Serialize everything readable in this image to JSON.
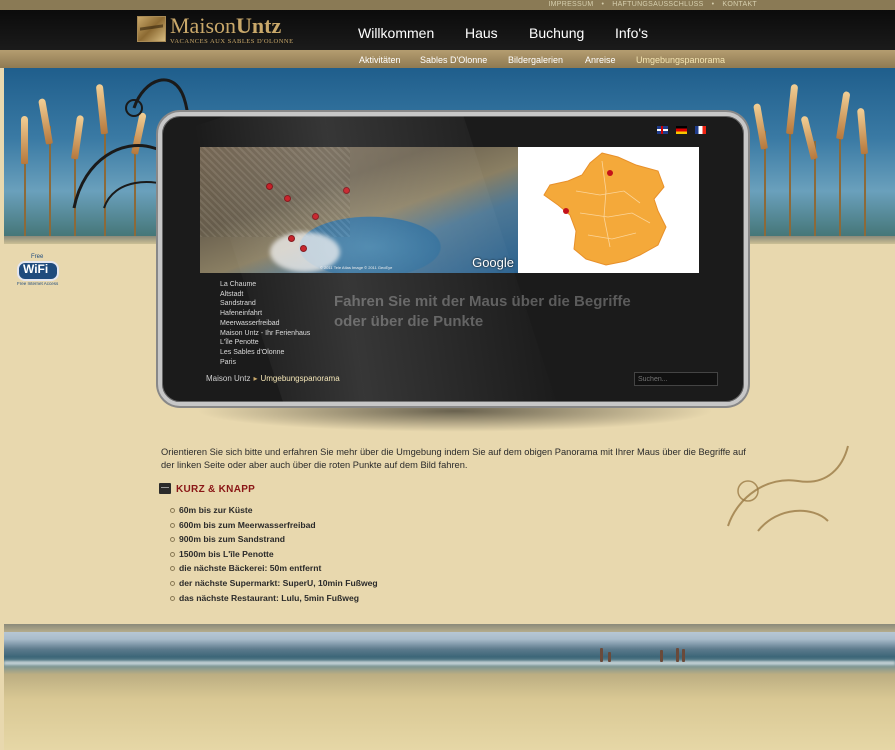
{
  "top_links": [
    "IMPRESSUM",
    "HAFTUNGSAUSSCHLUSS",
    "KONTAKT"
  ],
  "logo": {
    "name_light": "Maison",
    "name_bold": "Untz",
    "tagline": "VACANCES AUX SABLES D'OLONNE"
  },
  "main_nav": [
    "Willkommen",
    "Haus",
    "Buchung",
    "Info's"
  ],
  "sub_nav": [
    "Aktivitäten",
    "Sables D'Olonne",
    "Bildergalerien",
    "Anreise",
    "Umgebungspanorama"
  ],
  "wifi": {
    "free": "Free",
    "label": "WiFi",
    "sub": "Free Internet Access"
  },
  "map": {
    "provider": "Google",
    "copyright": "© 2011 Tele Atlas  Image © 2011 GeoEye"
  },
  "places": [
    "La Chaume",
    "Altstadt",
    "Sandstrand",
    "Hafeneinfahrt",
    "Meerwasserfreibad",
    "Maison Untz - Ihr Ferienhaus",
    "L'île Penotte",
    "Les Sables d'Olonne",
    "Paris"
  ],
  "hint": "Fahren Sie mit der Maus über die Begriffe oder über die Punkte",
  "breadcrumb": {
    "home": "Maison Untz",
    "current": "Umgebungspanorama"
  },
  "search": {
    "placeholder": "Suchen..."
  },
  "intro": "Orientieren Sie sich bitte und erfahren Sie mehr über die Umgebung indem Sie auf dem obigen Panorama mit Ihrer Maus über die Begriffe auf der linken Seite oder aber auch über die roten Punkte auf dem Bild fahren.",
  "section_title": "KURZ & KNAPP",
  "facts": [
    "60m bis zur Küste",
    "600m bis zum Meerwasserfreibad",
    "900m bis zum Sandstrand",
    "1500m bis L'île Penotte",
    "die nächste Bäckerei: 50m entfernt",
    "der nächste Supermarkt: SuperU, 10min Fußweg",
    "das nächste Restaurant: Lulu, 5min Fußweg"
  ],
  "colors": {
    "gold": "#c9a86a",
    "header_bg": "#111111",
    "section_red": "#8a1616",
    "map_dot": "#c4121a",
    "france_orange": "#f4a93a"
  }
}
